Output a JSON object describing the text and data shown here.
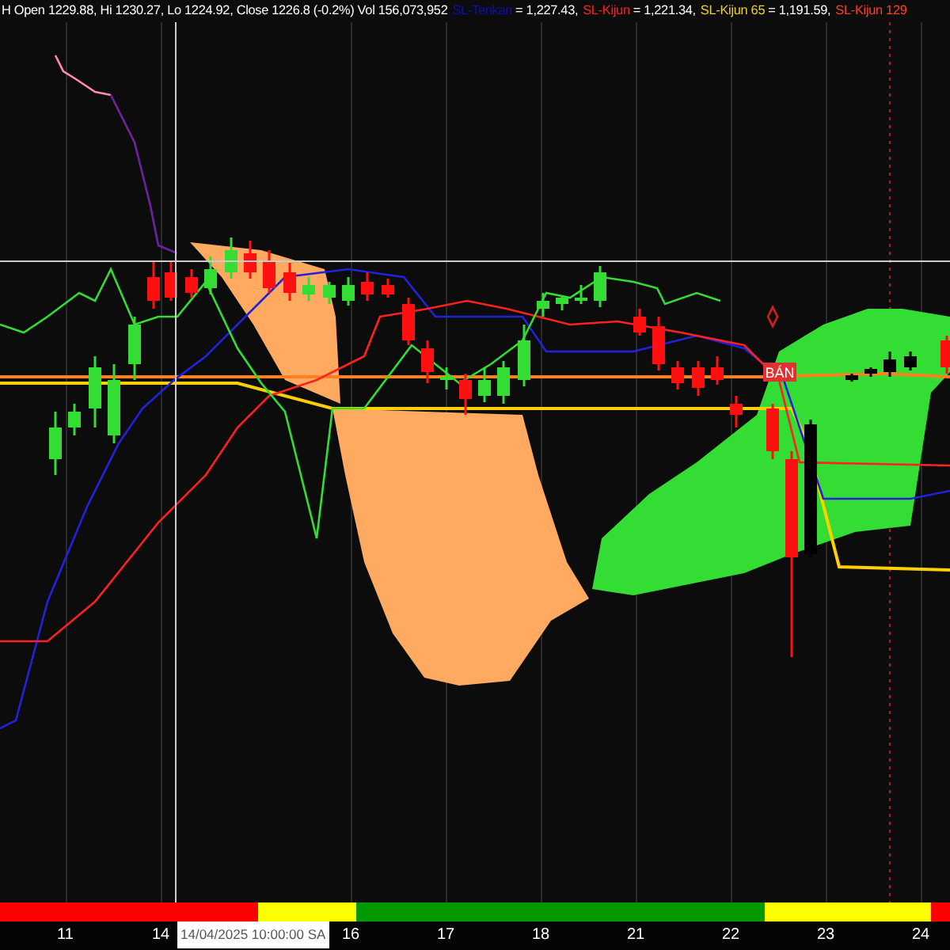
{
  "header": {
    "quote": "H Open 1229.88, Hi 1230.27, Lo 1224.92, Close 1226.8 (-0.2%) Vol 156,073,952",
    "indicators": [
      {
        "name": "SL-Tenkan",
        "value": "= 1,227.43,",
        "color": "#1010b0"
      },
      {
        "name": "SL-Kijun",
        "value": "= 1,221.34,",
        "color": "#ff2020"
      },
      {
        "name": "SL-Kijun 65",
        "value": "= 1,191.59,",
        "color": "#f0d020"
      },
      {
        "name": "SL-Kijun 129",
        "color": "#ff4020"
      }
    ]
  },
  "signal": {
    "label": "BÁN"
  },
  "trend_strip": [
    {
      "color": "#ff0000"
    },
    {
      "color": "#ffff00"
    },
    {
      "color": "#009900"
    },
    {
      "color": "#ffff00"
    },
    {
      "color": "#ff0000"
    }
  ],
  "x_axis": {
    "labels": [
      "11",
      "14",
      "16",
      "17",
      "18",
      "21",
      "22",
      "23",
      "24"
    ],
    "cursor_label": "14/04/2025 10:00:00 SA"
  }
}
